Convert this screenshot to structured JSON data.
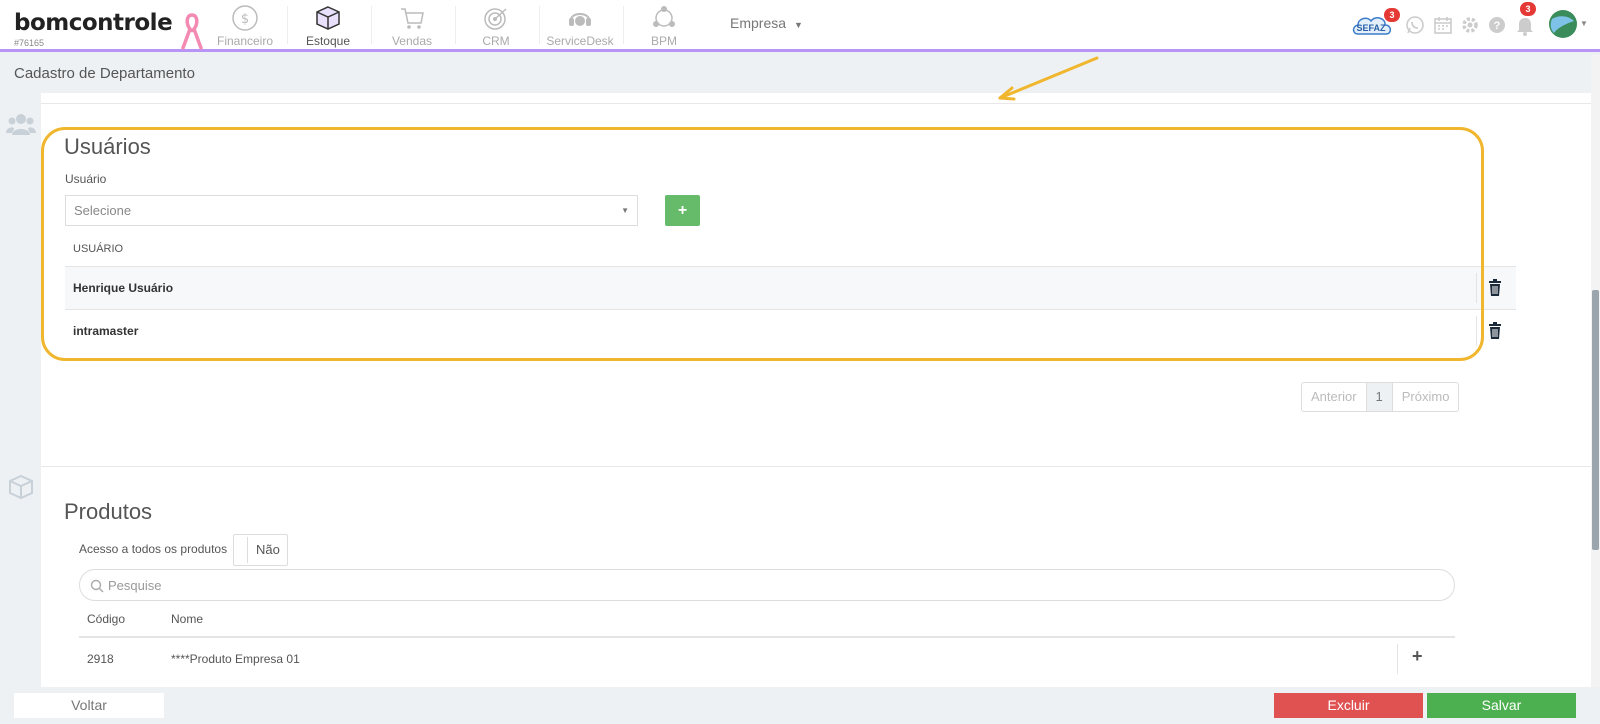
{
  "brand": {
    "name": "bomcontrole",
    "account": "#76165"
  },
  "nav": [
    {
      "label": "Financeiro",
      "icon": "dollar-circle-icon"
    },
    {
      "label": "Estoque",
      "icon": "box-icon"
    },
    {
      "label": "Vendas",
      "icon": "cart-icon"
    },
    {
      "label": "CRM",
      "icon": "target-icon"
    },
    {
      "label": "ServiceDesk",
      "icon": "headset-icon"
    },
    {
      "label": "BPM",
      "icon": "network-icon"
    }
  ],
  "empresa": {
    "label": "Empresa"
  },
  "top_right": {
    "sefaz_label": "SEFAZ",
    "sefaz_count": "3",
    "notif_count": "3"
  },
  "page": {
    "title": "Cadastro de Departamento"
  },
  "usuarios": {
    "title": "Usuários",
    "field_label": "Usuário",
    "select_placeholder": "Selecione",
    "add_label": "+",
    "column_header": "USUÁRIO",
    "rows": [
      {
        "name": "Henrique Usuário"
      },
      {
        "name": "intramaster"
      }
    ],
    "pagination": {
      "prev": "Anterior",
      "current": "1",
      "next": "Próximo"
    }
  },
  "produtos": {
    "title": "Produtos",
    "access_label": "Acesso a todos os produtos",
    "access_value": "Não",
    "search_placeholder": "Pesquise",
    "columns": {
      "code": "Código",
      "name": "Nome"
    },
    "rows": [
      {
        "code": "2918",
        "name": "****Produto Empresa 01"
      }
    ]
  },
  "footer": {
    "back": "Voltar",
    "delete": "Excluir",
    "save": "Salvar"
  },
  "colors": {
    "accent_purple": "#b794f6",
    "highlight": "#f0b62e",
    "add_green": "#66bb6a",
    "danger": "#e05252",
    "success": "#4caf50"
  }
}
